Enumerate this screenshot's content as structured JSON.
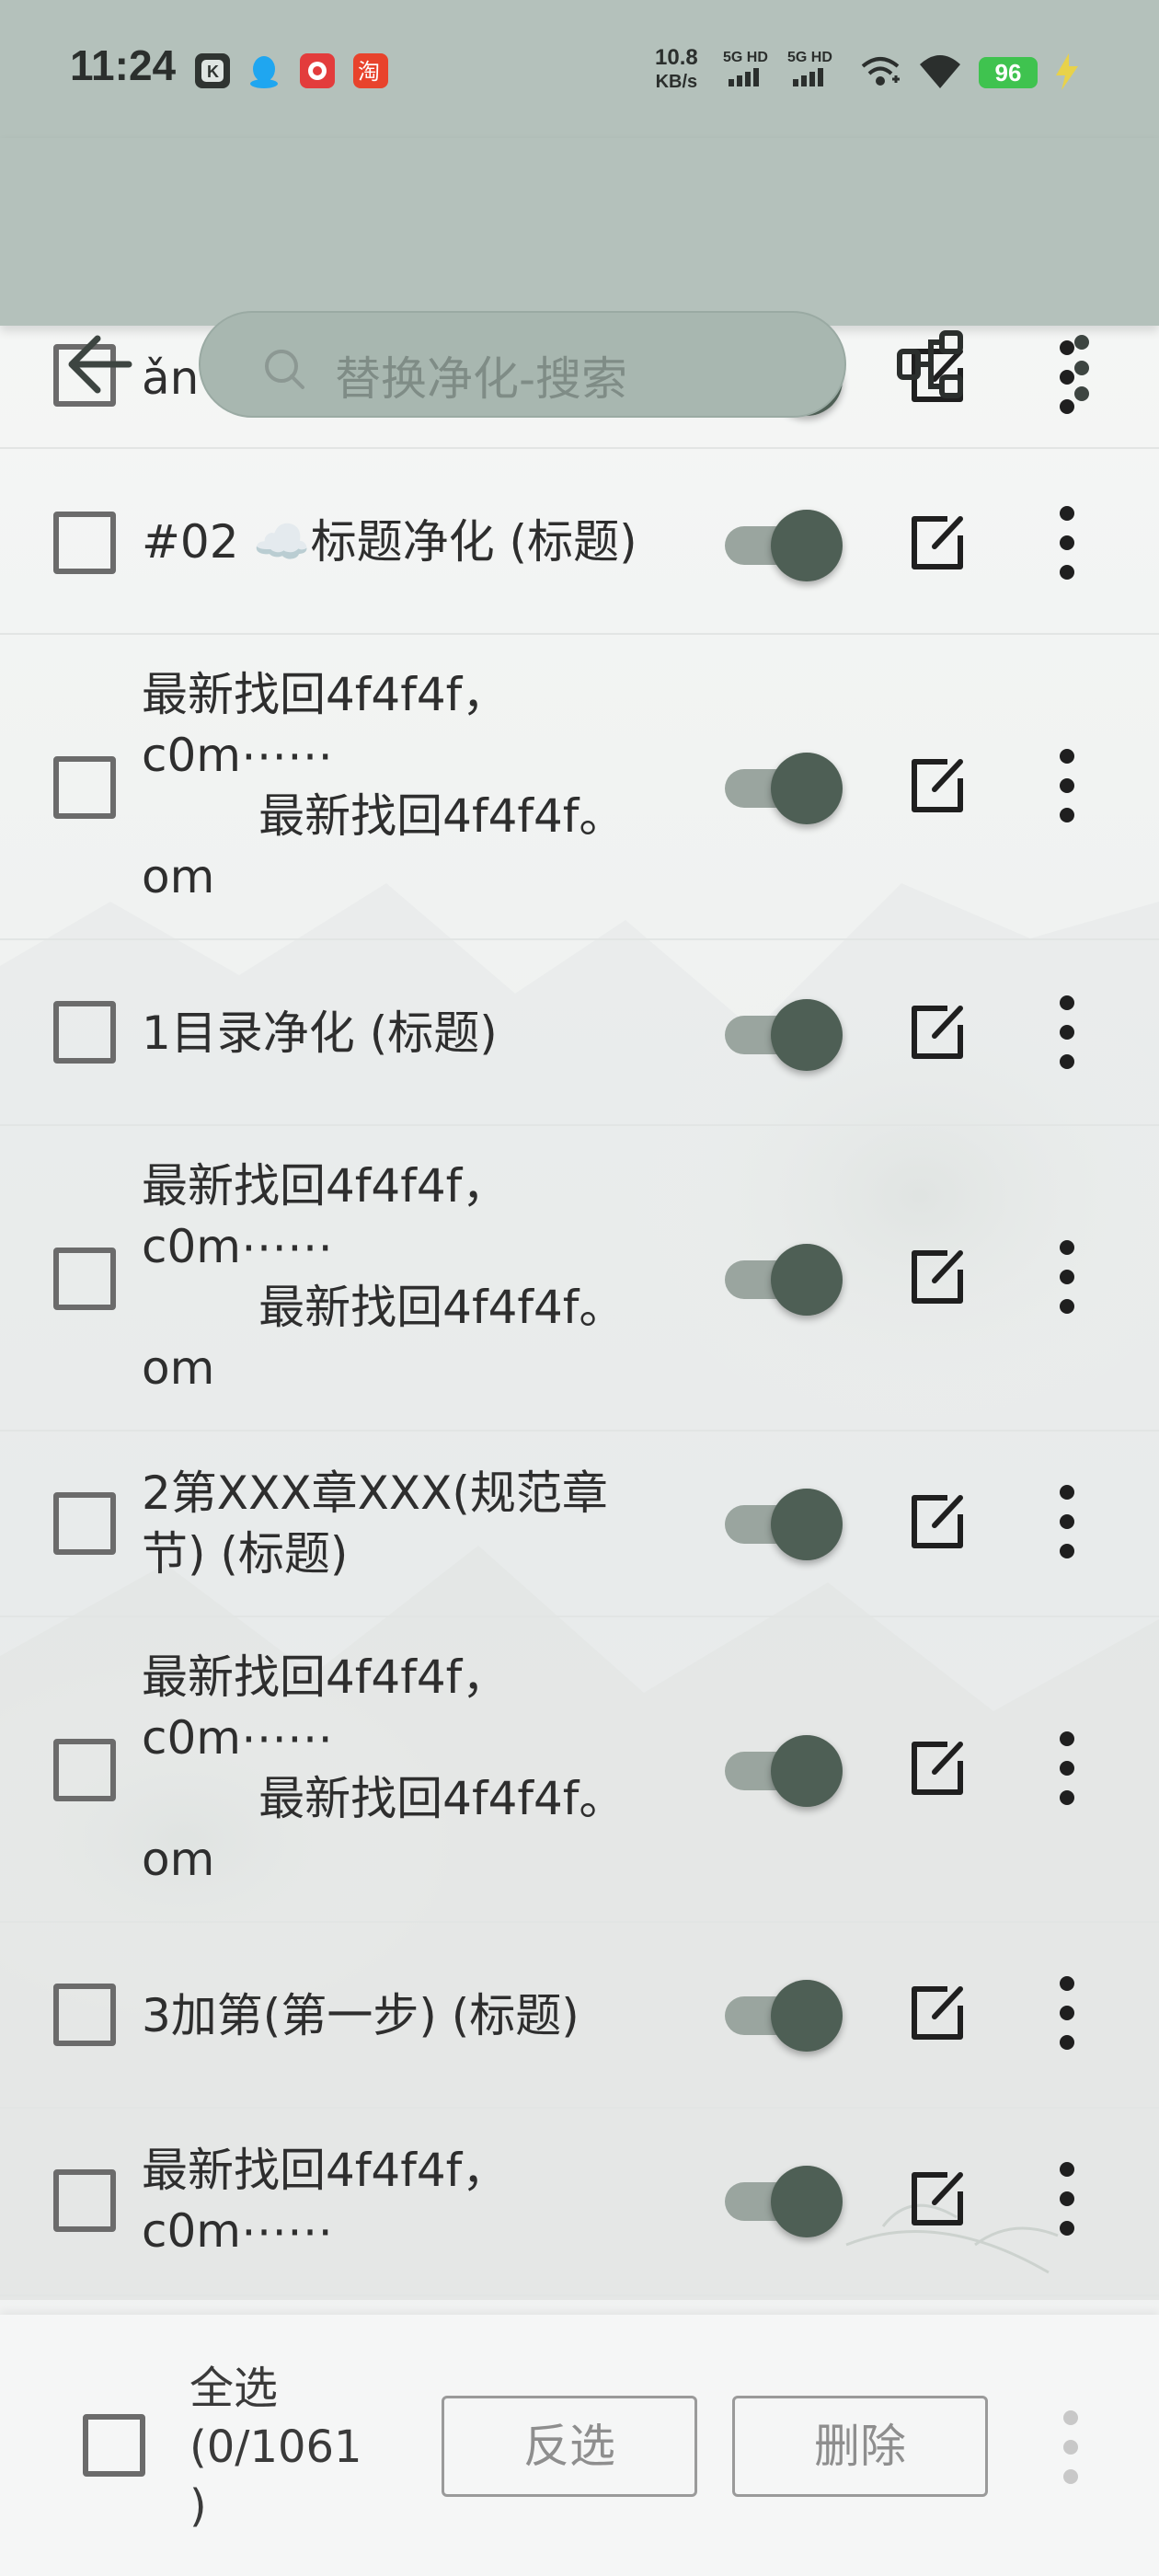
{
  "status_bar": {
    "time": "11:24",
    "net_speed_value": "10.8",
    "net_speed_unit": "KB/s",
    "signal1_label": "5G HD",
    "signal2_label": "5G HD",
    "battery": "96",
    "icons": [
      "k-app-icon",
      "qq-icon",
      "weibo-icon",
      "taobao-icon",
      "hotspot-icon",
      "wifi-icon",
      "charging-icon"
    ]
  },
  "toolbar": {
    "search_placeholder": "替换净化-搜索",
    "back_icon": "arrow-left-icon",
    "share_icon": "rule-group-icon",
    "menu_icon": "more-vert-icon"
  },
  "rules": [
    {
      "title": "ǎn",
      "enabled": true,
      "selected": false
    },
    {
      "title": "#02 ☁️标题净化 (标题)",
      "enabled": true,
      "selected": false
    },
    {
      "title": "最新找回4f4f4f，\nc0m⋯⋯\n        最新找回4f4f4f。\nom",
      "enabled": true,
      "selected": false
    },
    {
      "title": "1目录净化 (标题)",
      "enabled": true,
      "selected": false
    },
    {
      "title": "最新找回4f4f4f，\nc0m⋯⋯\n        最新找回4f4f4f。\nom",
      "enabled": true,
      "selected": false
    },
    {
      "title": "2第XXX章XXX(规范章\n节) (标题)",
      "enabled": true,
      "selected": false
    },
    {
      "title": "最新找回4f4f4f，\nc0m⋯⋯\n        最新找回4f4f4f。\nom",
      "enabled": true,
      "selected": false
    },
    {
      "title": "3加第(第一步) (标题)",
      "enabled": true,
      "selected": false
    },
    {
      "title": "最新找回4f4f4f，\nc0m⋯⋯",
      "enabled": true,
      "selected": false
    }
  ],
  "bottom_bar": {
    "select_all_label": "全选\n(0/1061\n)",
    "invert_label": "反选",
    "delete_label": "删除"
  },
  "colors": {
    "header_bg": "#b4c1bb",
    "switch_knob": "#4e5f55",
    "switch_track": "#9aa59f",
    "battery": "#3fc34f"
  }
}
